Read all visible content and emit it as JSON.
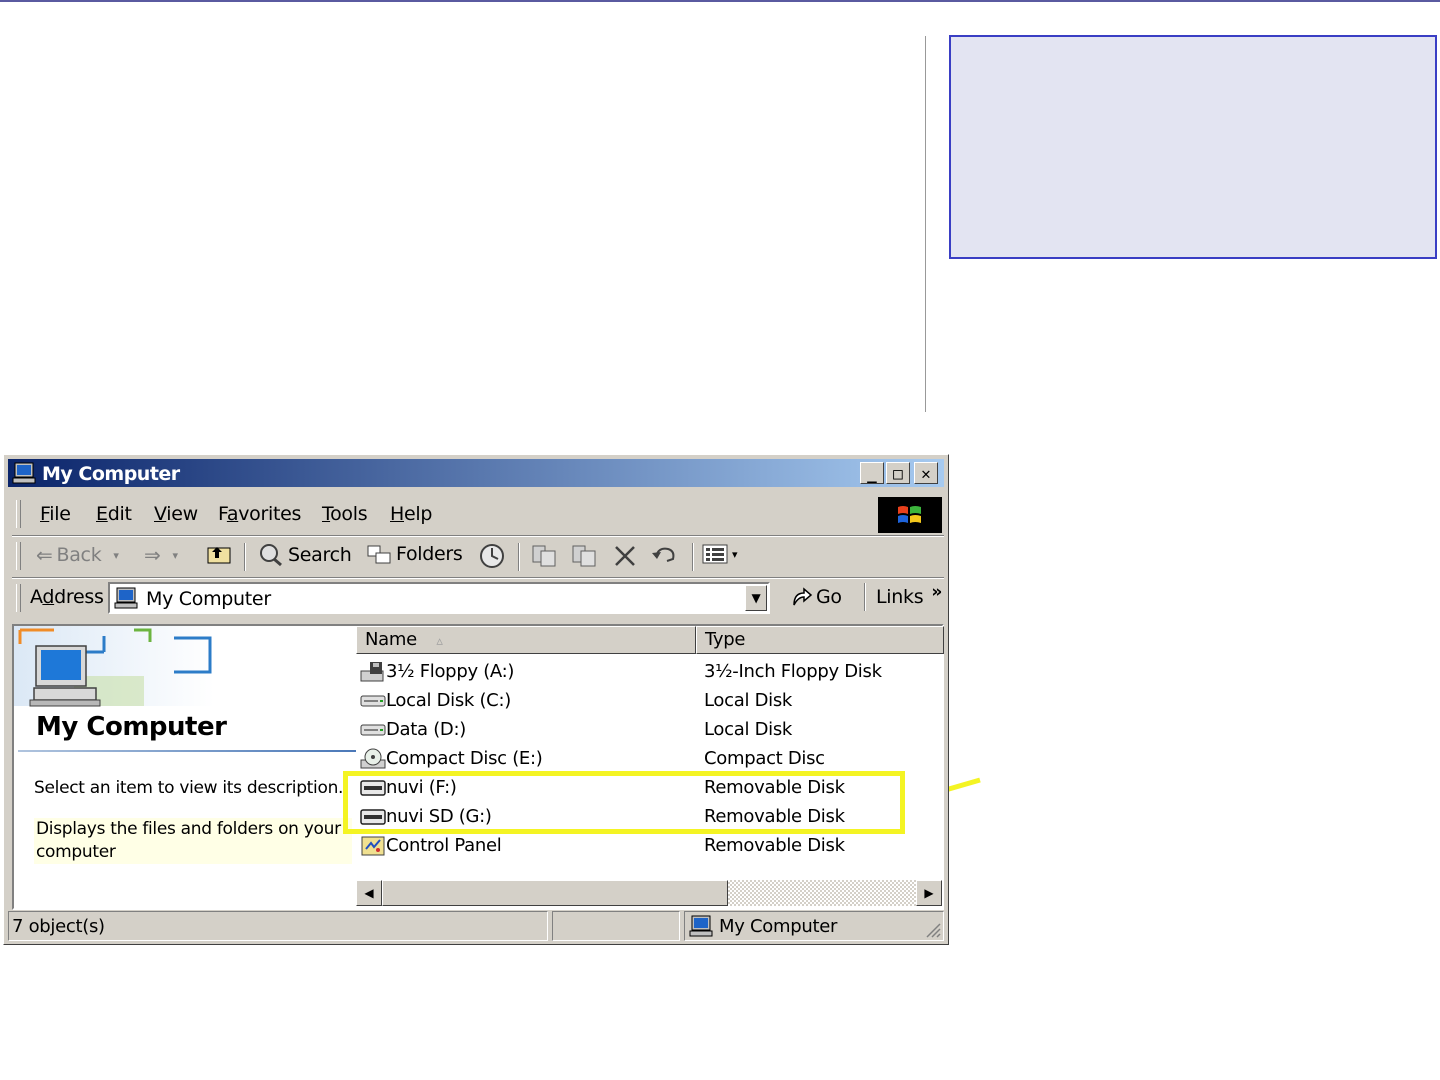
{
  "window": {
    "title": "My Computer",
    "controls": {
      "minimize": "_",
      "maximize": "□",
      "close": "✕"
    }
  },
  "menu": {
    "items": [
      {
        "label": "File",
        "accel": "F",
        "rest": "ile"
      },
      {
        "label": "Edit",
        "accel": "E",
        "rest": "dit"
      },
      {
        "label": "View",
        "accel": "V",
        "rest": "iew"
      },
      {
        "label": "Favorites",
        "pre": "F",
        "accel": "a",
        "rest": "vorites"
      },
      {
        "label": "Tools",
        "accel": "T",
        "rest": "ools"
      },
      {
        "label": "Help",
        "accel": "H",
        "rest": "elp"
      }
    ]
  },
  "toolbar": {
    "back_label": "Back",
    "search_label": "Search",
    "folders_label": "Folders"
  },
  "address": {
    "label_pre": "A",
    "label_accel": "d",
    "label_rest": "dress",
    "value": "My Computer",
    "go_label": "Go",
    "links_label": "Links",
    "more": "»"
  },
  "left_pane": {
    "heading": "My Computer",
    "select_hint": "Select an item to view its description.",
    "description": "Displays the files and folders on your computer"
  },
  "list": {
    "columns": [
      "Name",
      "Type"
    ],
    "sort_indicator": "▵",
    "rows": [
      {
        "name": "3½ Floppy (A:)",
        "type": "3½-Inch Floppy Disk",
        "icon": "floppy-drive-icon"
      },
      {
        "name": "Local Disk (C:)",
        "type": "Local Disk",
        "icon": "hard-disk-icon"
      },
      {
        "name": "Data (D:)",
        "type": "Local Disk",
        "icon": "hard-disk-icon"
      },
      {
        "name": "Compact Disc (E:)",
        "type": "Compact Disc",
        "icon": "cd-drive-icon"
      },
      {
        "name": "nuvi (F:)",
        "type": "Removable Disk",
        "icon": "removable-disk-icon"
      },
      {
        "name": "nuvi SD (G:)",
        "type": "Removable Disk",
        "icon": "removable-disk-icon"
      },
      {
        "name": "Control Panel",
        "type": "Removable Disk",
        "icon": "control-panel-icon"
      }
    ]
  },
  "status": {
    "count": "7 object(s)",
    "location": "My Computer"
  },
  "colors": {
    "title_gradient_start": "#0a246a",
    "title_gradient_end": "#a6caf0",
    "highlight": "#f4f423",
    "callout_fill": "#e3e4f2",
    "callout_border": "#3a3ec4"
  }
}
